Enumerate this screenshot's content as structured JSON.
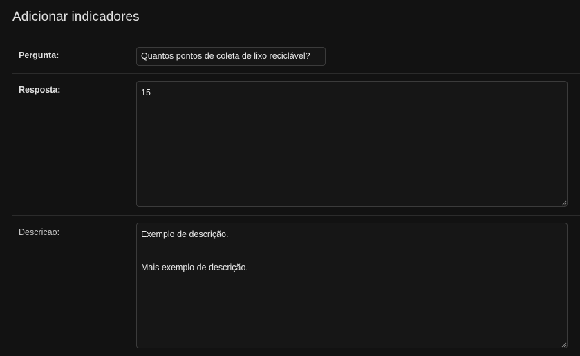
{
  "header": {
    "title": "Adicionar indicadores"
  },
  "form": {
    "pergunta": {
      "label": "Pergunta:",
      "value": "Quantos pontos de coleta de lixo reciclável?"
    },
    "resposta": {
      "label": "Resposta:",
      "value": "15"
    },
    "descricao": {
      "label": "Descricao:",
      "value": "Exemplo de descrição.\n\n\nMais exemplo de descrição."
    }
  },
  "icons": {
    "resize": "resize-grip-icon"
  },
  "colors": {
    "background": "#121212",
    "field_background": "#161616",
    "field_border": "#3b3b3b",
    "divider": "#2b2b2b",
    "text": "#e8e8e8"
  }
}
